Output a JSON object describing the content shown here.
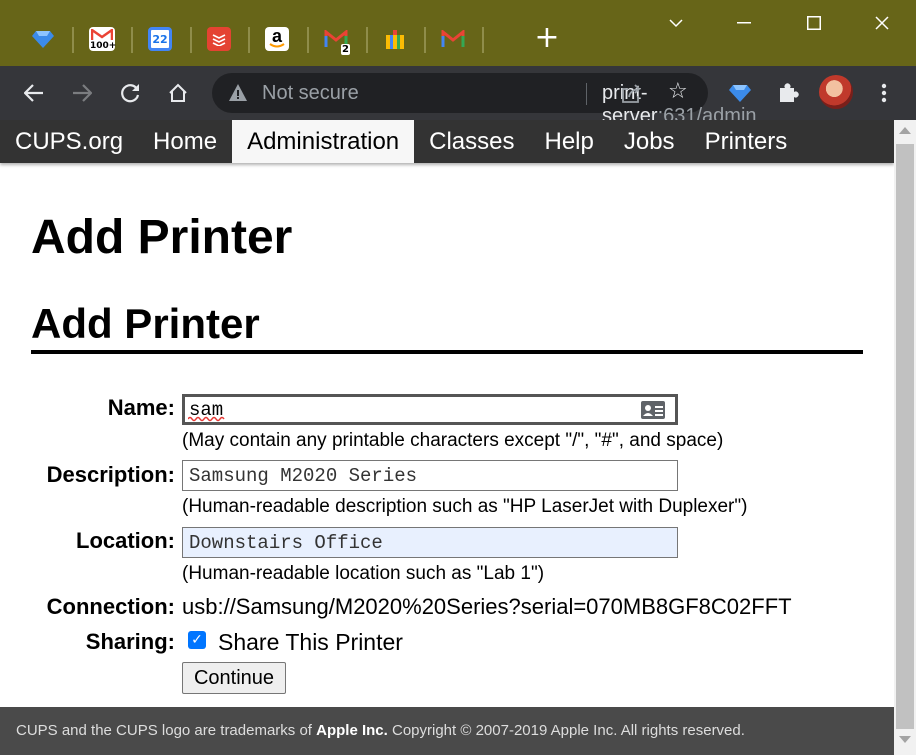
{
  "browser": {
    "tabs": [
      {
        "icon": "gem-icon",
        "text": ""
      },
      {
        "icon": "gmail-counter-icon",
        "text": "100+"
      },
      {
        "icon": "calendar-icon",
        "text": "22"
      },
      {
        "icon": "todoist-icon",
        "text": ""
      },
      {
        "icon": "amazon-icon",
        "text": "a"
      },
      {
        "icon": "gmail-2-icon",
        "text": "2"
      },
      {
        "icon": "gift-icon",
        "text": ""
      },
      {
        "icon": "gmail-icon",
        "text": ""
      }
    ],
    "new_tab": "+",
    "window_controls": [
      "minimize",
      "maximize",
      "close"
    ],
    "security_label": "Not secure",
    "url_host": "print-server",
    "url_rest": ":631/admin",
    "accent": "#676518"
  },
  "nav": {
    "items": [
      "CUPS.org",
      "Home",
      "Administration",
      "Classes",
      "Help",
      "Jobs",
      "Printers"
    ],
    "active": "Administration"
  },
  "page": {
    "title": "Add Printer",
    "section_title": "Add Printer"
  },
  "form": {
    "name_label": "Name:",
    "name_value": "sam",
    "name_hint": "(May contain any printable characters except \"/\", \"#\", and space)",
    "description_label": "Description:",
    "description_value": "Samsung M2020 Series",
    "description_hint": "(Human-readable description such as \"HP LaserJet with Duplexer\")",
    "location_label": "Location:",
    "location_value": "Downstairs Office",
    "location_hint": "(Human-readable location such as \"Lab 1\")",
    "connection_label": "Connection:",
    "connection_value": "usb://Samsung/M2020%20Series?serial=070MB8GF8C02FFT",
    "sharing_label": "Sharing:",
    "sharing_checked": true,
    "sharing_text": "Share This Printer",
    "continue_label": "Continue"
  },
  "footer": {
    "text_before": "CUPS and the CUPS logo are trademarks of ",
    "apple": "Apple Inc.",
    "text_after": " Copyright © 2007-2019 Apple Inc. All rights reserved."
  }
}
